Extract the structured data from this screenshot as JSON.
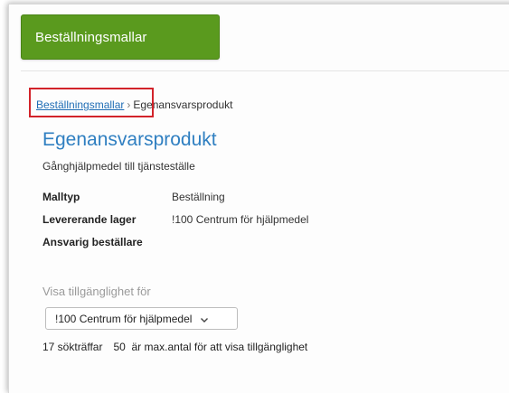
{
  "header": {
    "title": "Beställningsmallar"
  },
  "breadcrumb": {
    "link": "Beställningsmallar",
    "separator": "›",
    "current": "Egenansvarsprodukt"
  },
  "page": {
    "title": "Egenansvarsprodukt",
    "subtitle": "Gånghjälpmedel till tjänsteställe"
  },
  "properties": [
    {
      "label": "Malltyp",
      "value": "Beställning"
    },
    {
      "label": "Levererande lager",
      "value": "!100 Centrum för hjälpmedel"
    },
    {
      "label": "Ansvarig beställare",
      "value": ""
    }
  ],
  "availability": {
    "label": "Visa tillgänglighet för",
    "selected": "!100 Centrum för hjälpmedel"
  },
  "results": {
    "hits": "17 sökträffar",
    "max_text": "50  är max.antal för att visa tillgänglighet"
  },
  "colors": {
    "header_green": "#5a9a1e",
    "title_blue": "#2f7fc1",
    "link_blue": "#1f6db5",
    "highlight_red": "#d2232a"
  }
}
